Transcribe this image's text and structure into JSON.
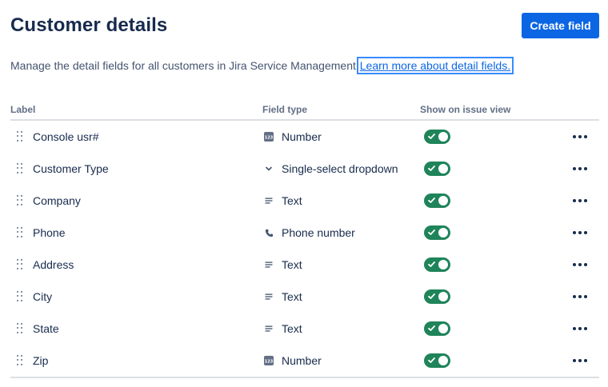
{
  "header": {
    "title": "Customer details",
    "create_button_label": "Create field"
  },
  "description": {
    "text": "Manage the detail fields for all customers in Jira Service Management.",
    "link_text": "Learn more about detail fields."
  },
  "table": {
    "columns": [
      "Label",
      "Field type",
      "Show on issue view"
    ],
    "rows": [
      {
        "label": "Console usr#",
        "type": "Number",
        "type_icon": "number-icon",
        "show_on_issue_view": true
      },
      {
        "label": "Customer Type",
        "type": "Single-select dropdown",
        "type_icon": "chevron-down-icon",
        "show_on_issue_view": true
      },
      {
        "label": "Company",
        "type": "Text",
        "type_icon": "text-lines-icon",
        "show_on_issue_view": true
      },
      {
        "label": "Phone",
        "type": "Phone number",
        "type_icon": "phone-icon",
        "show_on_issue_view": true
      },
      {
        "label": "Address",
        "type": "Text",
        "type_icon": "text-lines-icon",
        "show_on_issue_view": true
      },
      {
        "label": "City",
        "type": "Text",
        "type_icon": "text-lines-icon",
        "show_on_issue_view": true
      },
      {
        "label": "State",
        "type": "Text",
        "type_icon": "text-lines-icon",
        "show_on_issue_view": true
      },
      {
        "label": "Zip",
        "type": "Number",
        "type_icon": "number-icon",
        "show_on_issue_view": true
      }
    ]
  },
  "colors": {
    "primary": "#0c66e4",
    "toggle_on": "#1f845a",
    "text": "#172b4d",
    "subtle_text": "#44546f"
  }
}
